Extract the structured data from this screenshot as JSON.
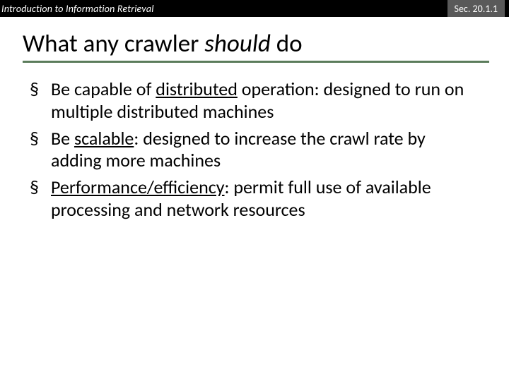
{
  "header": {
    "left": "Introduction to Information Retrieval",
    "section": "Sec. 20.1.1"
  },
  "title": {
    "prefix": "What any crawler ",
    "emph": "should",
    "suffix": " do"
  },
  "bullets": [
    {
      "pre": "Be capable of ",
      "u": "distributed",
      "post": " operation: designed to run on multiple distributed machines"
    },
    {
      "pre": "Be ",
      "u": "scalable",
      "post": ": designed to increase the crawl rate by adding more machines"
    },
    {
      "pre": "",
      "u": "Performance/efficiency",
      "post": ": permit full use of available processing and network resources"
    }
  ]
}
